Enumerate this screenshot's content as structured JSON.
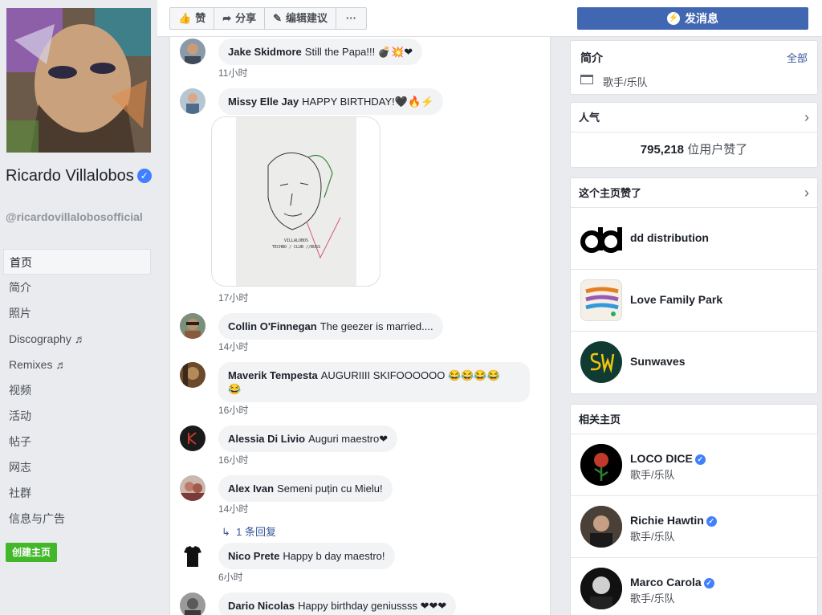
{
  "profile": {
    "name": "Ricardo Villalobos",
    "handle": "@ricardovillalobosofficial"
  },
  "nav": {
    "items": [
      "首页",
      "简介",
      "照片",
      "Discography ♬",
      "Remixes ♬",
      "视频",
      "活动",
      "帖子",
      "网志",
      "社群",
      "信息与广告"
    ],
    "create_page": "创建主页"
  },
  "actions": {
    "like": "赞",
    "share": "分享",
    "suggest_edit": "编辑建议",
    "more": "···",
    "message": "发消息"
  },
  "comments": [
    {
      "author": "Jake Skidmore",
      "text": "Still the Papa!!! 💣💥❤",
      "time": "11小时"
    },
    {
      "author": "Missy Elle Jay",
      "text": "HAPPY BIRTHDAY!🖤🔥⚡",
      "time": "17小时",
      "image_caption": "VILLALOBOS\nTECHNO / CLUB //BUSS"
    },
    {
      "author": "Collin O'Finnegan",
      "text": "The geezer is married....",
      "time": "14小时"
    },
    {
      "author": "Maverik Tempesta",
      "text": "AUGURIIII SKIFOOOOOO 😂😂😂😂",
      "text2": "😂",
      "time": "16小时"
    },
    {
      "author": "Alessia Di Livio",
      "text": "Auguri maestro❤",
      "time": "16小时"
    },
    {
      "author": "Alex Ivan",
      "text": "Semeni puțin cu Mielu!",
      "time": "14小时",
      "replies": "1 条回复"
    },
    {
      "author": "Nico Prete",
      "text": "Happy b day maestro!",
      "time": "6小时"
    },
    {
      "author": "Dario Nicolas",
      "text": "Happy birthday geniussss ❤❤❤",
      "time": ""
    }
  ],
  "about": {
    "title": "简介",
    "all_link": "全部",
    "category": "歌手/乐队"
  },
  "popularity": {
    "title": "人气",
    "count": "795,218",
    "suffix": "位用户赞了"
  },
  "liked_pages": {
    "title": "这个主页赞了",
    "items": [
      {
        "name": "dd distribution"
      },
      {
        "name": "Love Family Park"
      },
      {
        "name": "Sunwaves"
      }
    ]
  },
  "related_pages": {
    "title": "相关主页",
    "items": [
      {
        "name": "LOCO DICE",
        "category": "歌手/乐队"
      },
      {
        "name": "Richie Hawtin",
        "category": "歌手/乐队"
      },
      {
        "name": "Marco Carola",
        "category": "歌手/乐队"
      }
    ]
  },
  "colors": {
    "brand_blue": "#4267b2",
    "create_green": "#42b72a",
    "verified_blue": "#4080ff",
    "background": "#e9ebee"
  }
}
